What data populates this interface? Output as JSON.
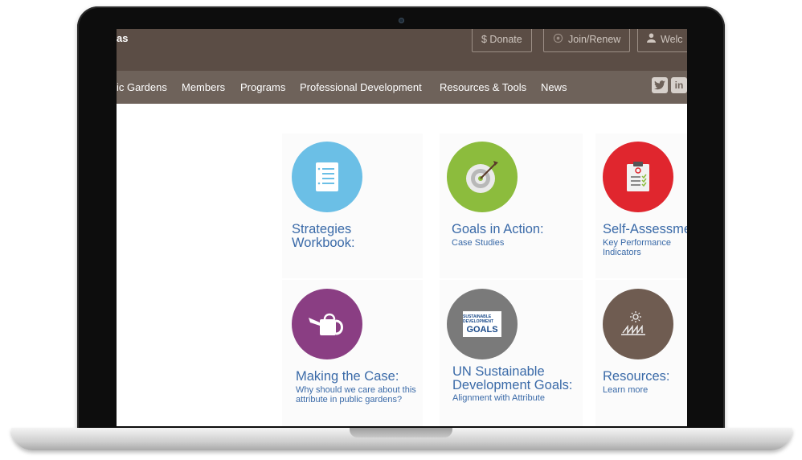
{
  "header": {
    "site_name_fragment": "as",
    "donate_label": "$ Donate",
    "join_label": "Join/Renew",
    "welcome_label": "Welc"
  },
  "nav": {
    "items": [
      {
        "label": "ic Gardens"
      },
      {
        "label": "Members"
      },
      {
        "label": "Programs"
      },
      {
        "label": "Professional Development"
      },
      {
        "label": "Resources & Tools"
      },
      {
        "label": "News"
      }
    ]
  },
  "social": {
    "twitter": "twitter-icon",
    "linkedin": "linkedin-icon"
  },
  "cards": [
    {
      "title": "Strategies",
      "title2": "Workbook:",
      "subtitle": "",
      "color": "#6bbfe6",
      "icon": "document-icon"
    },
    {
      "title": "Goals in Action:",
      "title2": "",
      "subtitle": "Case Studies",
      "color": "#8cbc3d",
      "icon": "target-icon"
    },
    {
      "title": "Self-Assessme",
      "title2": "",
      "subtitle": "Key Performance Indicators",
      "color": "#e0262e",
      "icon": "checklist-icon"
    },
    {
      "title": "Making the Case:",
      "title2": "",
      "subtitle": "Why should we care about this attribute in public gardens?",
      "color": "#8a3e83",
      "icon": "watering-can-icon"
    },
    {
      "title": "UN Sustainable",
      "title2": "Development Goals:",
      "subtitle": "Alignment with Attribute",
      "color": "#7a7a7a",
      "icon": "sdg-logo-icon",
      "badge_small": "SUSTAINABLE DEVELOPMENT",
      "badge_big": "GOALS"
    },
    {
      "title": "Resources:",
      "title2": "",
      "subtitle": "Learn more",
      "color": "#6f5c51",
      "icon": "growth-icon"
    }
  ],
  "colors": {
    "topbar": "#5b4d45",
    "navbar": "#6e625a",
    "link": "#3a6aa8"
  }
}
